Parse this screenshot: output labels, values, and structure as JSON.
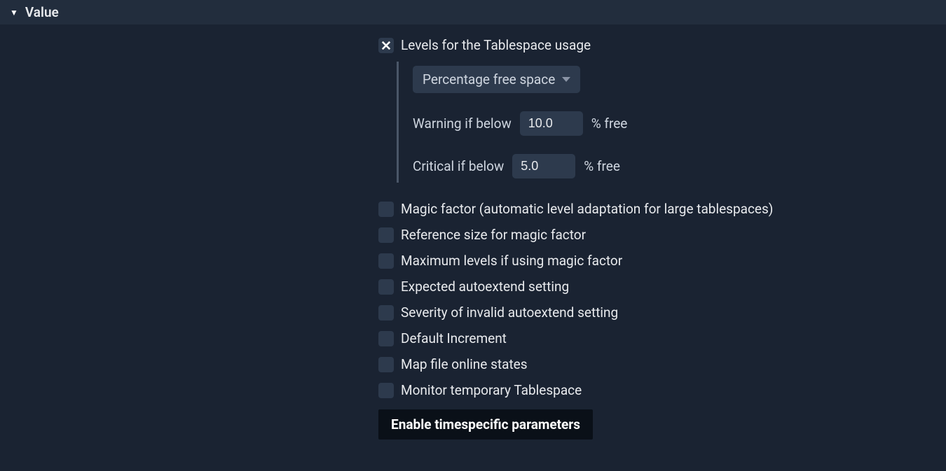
{
  "section": {
    "title": "Value"
  },
  "levels": {
    "label": "Levels for the Tablespace usage",
    "mode": "Percentage free space",
    "warning_label": "Warning if below",
    "warning_value": "10.0",
    "warning_unit": "% free",
    "critical_label": "Critical if below",
    "critical_value": "5.0",
    "critical_unit": "% free"
  },
  "options": [
    {
      "label": "Magic factor (automatic level adaptation for large tablespaces)"
    },
    {
      "label": "Reference size for magic factor"
    },
    {
      "label": "Maximum levels if using magic factor"
    },
    {
      "label": "Expected autoextend setting"
    },
    {
      "label": "Severity of invalid autoextend setting"
    },
    {
      "label": "Default Increment"
    },
    {
      "label": "Map file online states"
    },
    {
      "label": "Monitor temporary Tablespace"
    }
  ],
  "enable_button": "Enable timespecific parameters"
}
